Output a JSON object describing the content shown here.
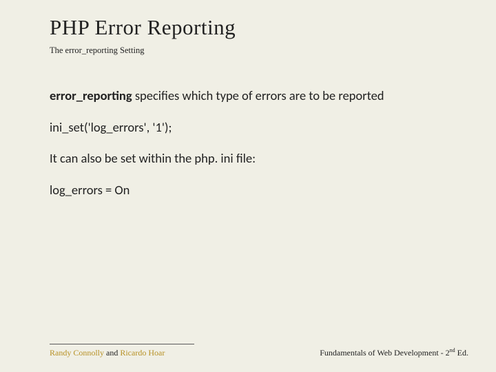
{
  "title": "PHP Error Reporting",
  "subtitle": "The error_reporting Setting",
  "body": {
    "p1_bold": "error_reporting",
    "p1_rest": "  specifies which type of errors are to be reported",
    "p2": "ini_set('log_errors', '1');",
    "p3": "It can also be set within the php. ini file:",
    "p4": "log_errors = On"
  },
  "footer": {
    "author1": "Randy Connolly",
    "joiner": " and ",
    "author2": "Ricardo Hoar",
    "book_prefix": "Fundamentals of Web Development - 2",
    "book_sup": "nd",
    "book_suffix": " Ed."
  }
}
